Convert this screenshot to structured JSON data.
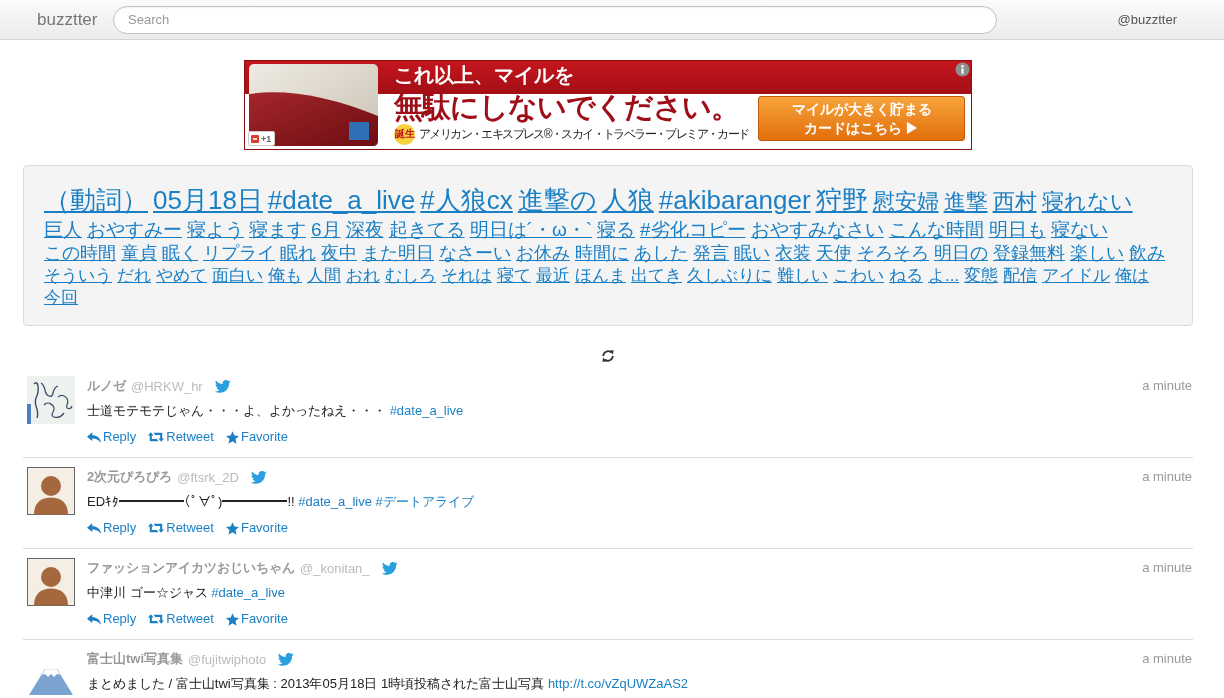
{
  "header": {
    "logo": "buzztter",
    "search": {
      "placeholder": "Search"
    },
    "account": "@buzztter"
  },
  "ad": {
    "headline": "これ以上、マイルを",
    "tagline": "無駄にしないでください。",
    "badge": "誕生",
    "product": "アメリカン・エキスプレス®・スカイ・トラベラー・プレミア・カード",
    "cta_lines": [
      "マイルが大きく貯まる",
      "カードはこちら ▶"
    ],
    "plus_one": "+1"
  },
  "tag_cloud": {
    "tags": [
      {
        "text": "（動詞）",
        "kind": "huge"
      },
      {
        "text": "05月18日",
        "kind": "huge"
      },
      {
        "text": "#date_a_live",
        "kind": "huge"
      },
      {
        "text": "#人狼cx",
        "kind": "huge"
      },
      {
        "text": "進撃の",
        "kind": "huge"
      },
      {
        "text": "人狼",
        "kind": "huge"
      },
      {
        "text": "#akibaranger",
        "kind": "huge"
      },
      {
        "text": "狩野",
        "kind": "huge"
      },
      {
        "text": "慰安婦",
        "kind": "large"
      },
      {
        "text": "進撃",
        "kind": "large"
      },
      {
        "text": "西村",
        "kind": "large"
      },
      {
        "text": "寝れない",
        "kind": "large"
      },
      {
        "text": "巨人",
        "kind": "medium"
      },
      {
        "text": "おやすみー",
        "kind": "medium"
      },
      {
        "text": "寝よう",
        "kind": "medium"
      },
      {
        "text": "寝ます",
        "kind": "medium"
      },
      {
        "text": "6月",
        "kind": "medium"
      },
      {
        "text": "深夜",
        "kind": "medium"
      },
      {
        "text": "起きてる",
        "kind": "medium"
      },
      {
        "text": "明日は´・ω・`",
        "kind": "medium"
      },
      {
        "text": "寝る",
        "kind": "medium"
      },
      {
        "text": "#劣化コピー",
        "kind": "medium"
      },
      {
        "text": "おやすみなさい",
        "kind": "medium"
      },
      {
        "text": "こんな時間",
        "kind": "medium"
      },
      {
        "text": "明日も",
        "kind": "medium"
      },
      {
        "text": "寝ない",
        "kind": "medium"
      },
      {
        "text": "この時間",
        "kind": "small"
      },
      {
        "text": "童貞",
        "kind": "small"
      },
      {
        "text": "眠く",
        "kind": "small"
      },
      {
        "text": "リプライ",
        "kind": "small"
      },
      {
        "text": "眠れ",
        "kind": "small"
      },
      {
        "text": "夜中",
        "kind": "small"
      },
      {
        "text": "また明日",
        "kind": "small"
      },
      {
        "text": "なさーい",
        "kind": "small"
      },
      {
        "text": "お休み",
        "kind": "small"
      },
      {
        "text": "時間に",
        "kind": "small"
      },
      {
        "text": "あした",
        "kind": "small"
      },
      {
        "text": "発言",
        "kind": "small"
      },
      {
        "text": "眠い",
        "kind": "small"
      },
      {
        "text": "衣装",
        "kind": "small"
      },
      {
        "text": "天使",
        "kind": "small"
      },
      {
        "text": "そろそろ",
        "kind": "small"
      },
      {
        "text": "明日の",
        "kind": "small"
      },
      {
        "text": "登録無料",
        "kind": "small"
      },
      {
        "text": "楽しい",
        "kind": "small"
      },
      {
        "text": "飲み",
        "kind": "small"
      },
      {
        "text": "そういう",
        "kind": "tiny"
      },
      {
        "text": "だれ",
        "kind": "tiny"
      },
      {
        "text": "やめて",
        "kind": "tiny"
      },
      {
        "text": "面白い",
        "kind": "tiny"
      },
      {
        "text": "俺も",
        "kind": "tiny"
      },
      {
        "text": "人間",
        "kind": "tiny"
      },
      {
        "text": "おれ",
        "kind": "tiny"
      },
      {
        "text": "むしろ",
        "kind": "tiny"
      },
      {
        "text": "それは",
        "kind": "tiny"
      },
      {
        "text": "寝て",
        "kind": "tiny"
      },
      {
        "text": "最近",
        "kind": "tiny"
      },
      {
        "text": "ほんま",
        "kind": "tiny"
      },
      {
        "text": "出てき",
        "kind": "tiny"
      },
      {
        "text": "久しぶりに",
        "kind": "tiny"
      },
      {
        "text": "難しい",
        "kind": "tiny"
      },
      {
        "text": "こわい",
        "kind": "tiny"
      },
      {
        "text": "ねる",
        "kind": "tiny"
      },
      {
        "text": "よ...",
        "kind": "tiny"
      },
      {
        "text": "変態",
        "kind": "tiny"
      },
      {
        "text": "配信",
        "kind": "tiny"
      },
      {
        "text": "アイドル",
        "kind": "tiny"
      },
      {
        "text": "俺は",
        "kind": "tiny"
      },
      {
        "text": "今回",
        "kind": "tiny"
      }
    ]
  },
  "timeline": {
    "tweets": [
      {
        "avatar": {
          "kind": "scribble"
        },
        "name": "ルノゼ",
        "handle": "@HRKW_hr",
        "segments": [
          {
            "kind": "text",
            "text": "士道モテモテじゃん・・・よ、よかったねえ・・・"
          },
          {
            "kind": "hashtag",
            "text": "#date_a_live"
          }
        ],
        "actions": [
          {
            "kind": "reply",
            "label": "Reply"
          },
          {
            "kind": "retweet",
            "label": "Retweet"
          },
          {
            "kind": "favorite",
            "label": "Favorite"
          }
        ],
        "time": "a minute"
      },
      {
        "avatar": {
          "kind": "portrait"
        },
        "name": "2次元ぴろぴろ",
        "handle": "@ftsrk_2D",
        "segments": [
          {
            "kind": "text",
            "text": "EDｷﾀ━━━━━(ﾟ∀ﾟ)━━━━━!!"
          },
          {
            "kind": "hashtag",
            "text": "#date_a_live"
          },
          {
            "kind": "hashtag",
            "text": "#デートアライブ"
          }
        ],
        "actions": [
          {
            "kind": "reply",
            "label": "Reply"
          },
          {
            "kind": "retweet",
            "label": "Retweet"
          },
          {
            "kind": "favorite",
            "label": "Favorite"
          }
        ],
        "time": "a minute"
      },
      {
        "avatar": {
          "kind": "portrait"
        },
        "name": "ファッションアイカツおじいちゃん",
        "handle": "@_konitan_",
        "segments": [
          {
            "kind": "text",
            "text": "中津川 ゴー☆ジャス"
          },
          {
            "kind": "hashtag",
            "text": "#date_a_live"
          }
        ],
        "actions": [
          {
            "kind": "reply",
            "label": "Reply"
          },
          {
            "kind": "retweet",
            "label": "Retweet"
          },
          {
            "kind": "favorite",
            "label": "Favorite"
          }
        ],
        "time": "a minute"
      },
      {
        "avatar": {
          "kind": "mountain"
        },
        "name": "富士山twi写真集",
        "handle": "@fujitwiphoto",
        "segments": [
          {
            "kind": "text",
            "text": "まとめました / 富士山twi写真集 : 2013年05月18日 1時頃投稿された富士山写真"
          },
          {
            "kind": "url",
            "text": "http://t.co/vZqUWZaAS2"
          }
        ],
        "time": "a minute"
      }
    ]
  }
}
